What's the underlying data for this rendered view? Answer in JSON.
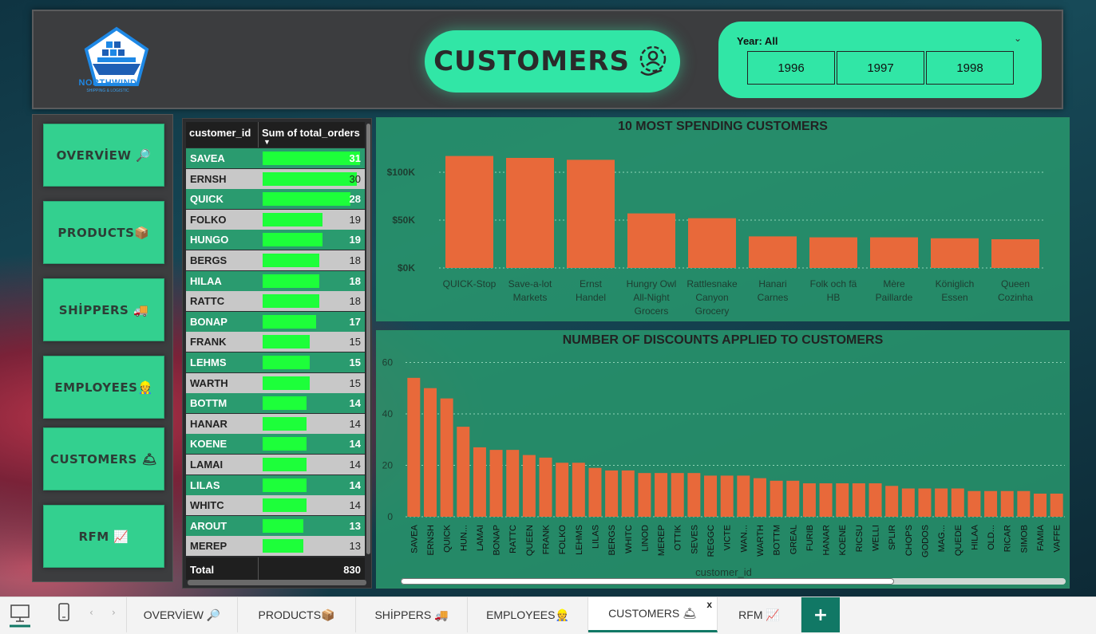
{
  "header": {
    "logo_text": "NORTHWIND",
    "logo_subtext": "SHIPPING & LOGISTIC",
    "title": "CUSTOMERS",
    "year_filter": {
      "label": "Year: All",
      "options": [
        "1996",
        "1997",
        "1998"
      ]
    }
  },
  "sidebar": {
    "items": [
      {
        "label": "OVERVİEW 🔎"
      },
      {
        "label": "PRODUCTS📦"
      },
      {
        "label": "SHİPPERS 🚚"
      },
      {
        "label": "EMPLOYEES👷"
      },
      {
        "label": "CUSTOMERS 🛎"
      },
      {
        "label": "RFM 📈"
      }
    ]
  },
  "table": {
    "columns": [
      "customer_id",
      "Sum of total_orders"
    ],
    "rows": [
      {
        "id": "SAVEA",
        "value": 31
      },
      {
        "id": "ERNSH",
        "value": 30
      },
      {
        "id": "QUICK",
        "value": 28
      },
      {
        "id": "FOLKO",
        "value": 19
      },
      {
        "id": "HUNGO",
        "value": 19
      },
      {
        "id": "BERGS",
        "value": 18
      },
      {
        "id": "HILAA",
        "value": 18
      },
      {
        "id": "RATTC",
        "value": 18
      },
      {
        "id": "BONAP",
        "value": 17
      },
      {
        "id": "FRANK",
        "value": 15
      },
      {
        "id": "LEHMS",
        "value": 15
      },
      {
        "id": "WARTH",
        "value": 15
      },
      {
        "id": "BOTTM",
        "value": 14
      },
      {
        "id": "HANAR",
        "value": 14
      },
      {
        "id": "KOENE",
        "value": 14
      },
      {
        "id": "LAMAI",
        "value": 14
      },
      {
        "id": "LILAS",
        "value": 14
      },
      {
        "id": "WHITC",
        "value": 14
      },
      {
        "id": "AROUT",
        "value": 13
      },
      {
        "id": "MEREP",
        "value": 13
      }
    ],
    "total_label": "Total",
    "total_value": "830",
    "max_value": 31
  },
  "chart_data": [
    {
      "type": "bar",
      "title": "10 MOST SPENDING CUSTOMERS",
      "categories": [
        "QUICK-Stop",
        "Save-a-lot Markets",
        "Ernst Handel",
        "Hungry Owl All-Night Grocers",
        "Rattlesnake Canyon Grocery",
        "Hanari Carnes",
        "Folk och fä HB",
        "Mère Paillarde",
        "Königlich Essen",
        "Queen Cozinha"
      ],
      "category_lines": [
        [
          "QUICK-Stop"
        ],
        [
          "Save-a-lot",
          "Markets"
        ],
        [
          "Ernst",
          "Handel"
        ],
        [
          "Hungry Owl",
          "All-Night",
          "Grocers"
        ],
        [
          "Rattlesnake",
          "Canyon",
          "Grocery"
        ],
        [
          "Hanari",
          "Carnes"
        ],
        [
          "Folk och fä",
          "HB"
        ],
        [
          "Mère",
          "Paillarde"
        ],
        [
          "Königlich",
          "Essen"
        ],
        [
          "Queen",
          "Cozinha"
        ]
      ],
      "values": [
        117000,
        115000,
        113000,
        57000,
        52000,
        33000,
        32000,
        32000,
        31000,
        30000
      ],
      "yticks": [
        0,
        50000,
        100000
      ],
      "ytick_labels": [
        "$0K",
        "$50K",
        "$100K"
      ],
      "ylim": [
        0,
        125000
      ],
      "bar_color": "#e8693a",
      "grid": true
    },
    {
      "type": "bar",
      "title": "NUMBER OF DISCOUNTS APPLIED TO CUSTOMERS",
      "xlabel": "customer_id",
      "categories": [
        "SAVEA",
        "ERNSH",
        "QUICK",
        "HUN...",
        "LAMAI",
        "BONAP",
        "RATTC",
        "QUEEN",
        "FRANK",
        "FOLKO",
        "LEHMS",
        "LILAS",
        "BERGS",
        "WHITC",
        "LINOD",
        "MEREP",
        "OTTIK",
        "SEVES",
        "REGGC",
        "VICTE",
        "WAN...",
        "WARTH",
        "BOTTM",
        "GREAL",
        "FURIB",
        "HANAR",
        "KOENE",
        "RICSU",
        "WELLI",
        "SPLIR",
        "CHOPS",
        "GODOS",
        "MAG...",
        "QUEDE",
        "HILAA",
        "OLD...",
        "RICAR",
        "SIMOB",
        "FAMIA",
        "VAFFE"
      ],
      "values": [
        54,
        50,
        46,
        35,
        27,
        26,
        26,
        24,
        23,
        21,
        21,
        19,
        18,
        18,
        17,
        17,
        17,
        17,
        16,
        16,
        16,
        15,
        14,
        14,
        13,
        13,
        13,
        13,
        13,
        12,
        11,
        11,
        11,
        11,
        10,
        10,
        10,
        10,
        9,
        9
      ],
      "yticks": [
        0,
        20,
        40,
        60
      ],
      "ylim": [
        0,
        62
      ],
      "bar_color": "#e8693a",
      "grid": true
    }
  ],
  "tabs": [
    {
      "label": "OVERVİEW 🔎"
    },
    {
      "label": "PRODUCTS📦"
    },
    {
      "label": "SHİPPERS 🚚"
    },
    {
      "label": "EMPLOYEES👷"
    },
    {
      "label": "CUSTOMERS 🛎"
    },
    {
      "label": "RFM 📈"
    }
  ],
  "tab_close": "x",
  "tab_add": "+",
  "colors": {
    "accent": "#31e6a6",
    "panel": "#2a9b6f",
    "bar": "#e8693a",
    "table_bar": "#1dff3a",
    "tab_active": "#117865"
  }
}
